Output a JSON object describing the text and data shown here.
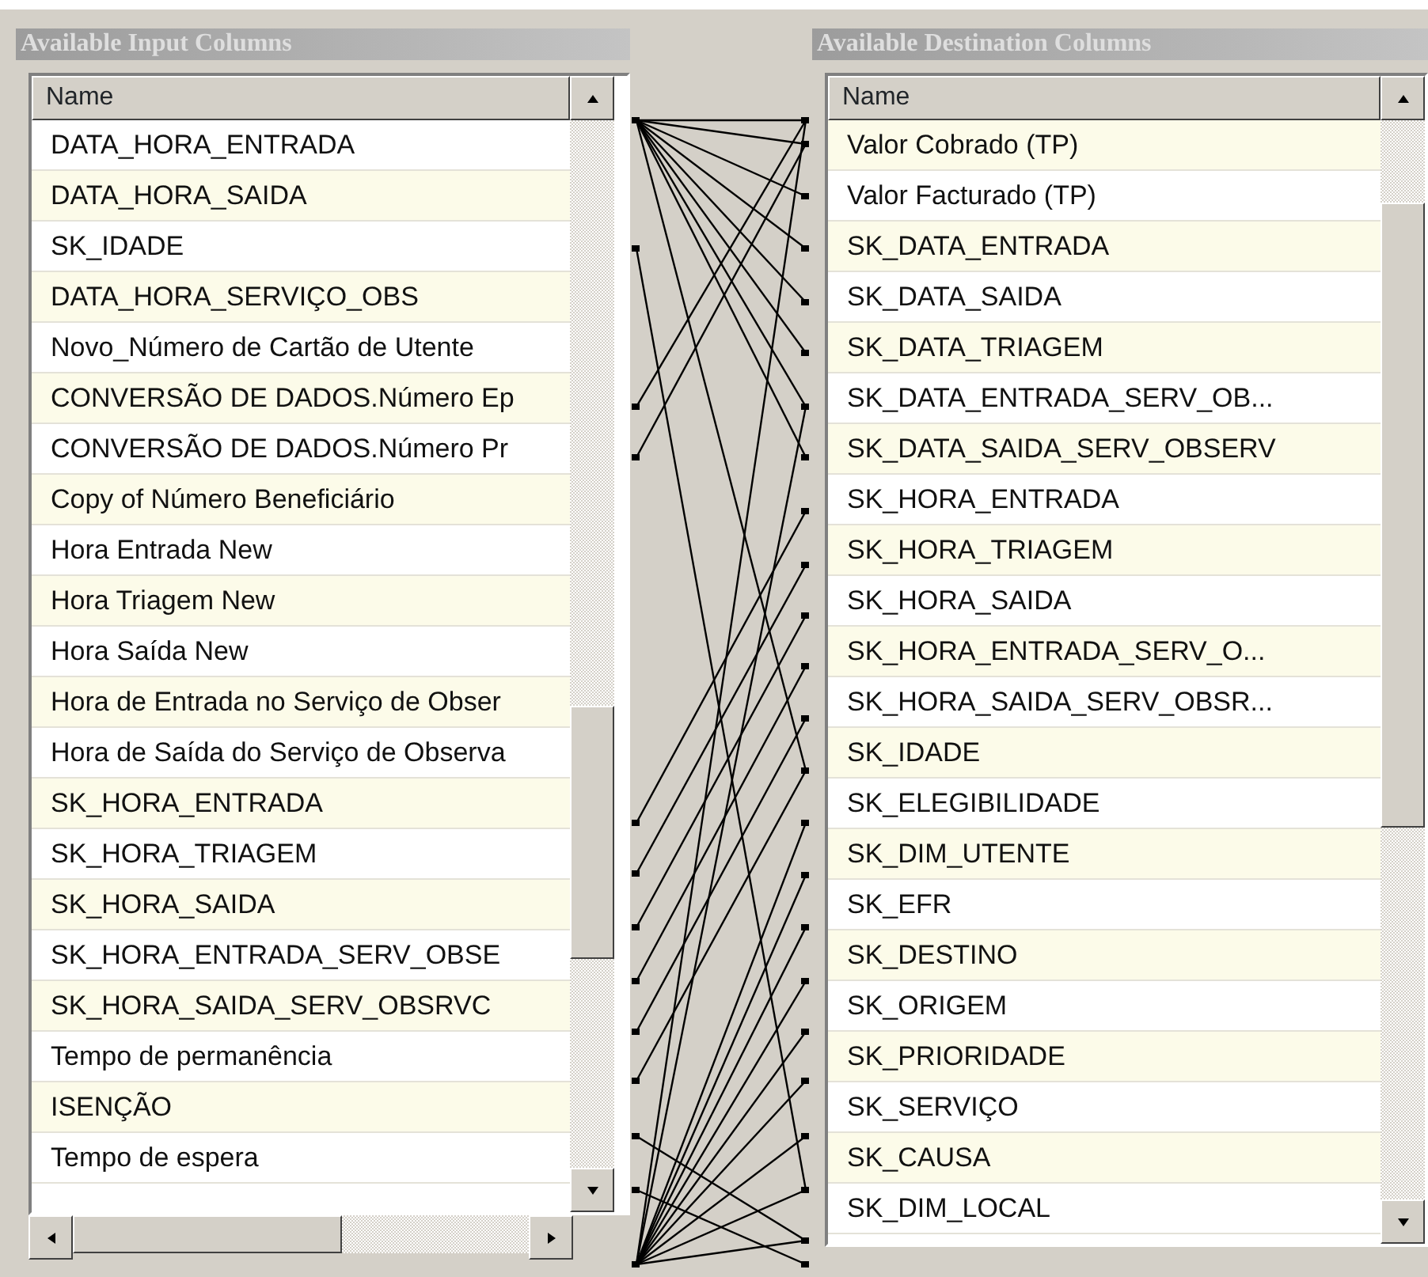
{
  "input_panel": {
    "title": "Available Input Columns",
    "header": "Name",
    "first_row_shaded": false,
    "rows": [
      "DATA_HORA_ENTRADA",
      "DATA_HORA_SAIDA",
      "SK_IDADE",
      "DATA_HORA_SERVIÇO_OBS",
      "Novo_Número de Cartão de Utente",
      "CONVERSÃO DE DADOS.Número Ep",
      "CONVERSÃO DE DADOS.Número Pr",
      "Copy of Número Beneficiário",
      "Hora Entrada New",
      "Hora Triagem New",
      "Hora Saída New",
      "Hora de Entrada no Serviço de Obser",
      "Hora de Saída do Serviço de Observa",
      "SK_HORA_ENTRADA",
      "SK_HORA_TRIAGEM",
      "SK_HORA_SAIDA",
      "SK_HORA_ENTRADA_SERV_OBSE",
      "SK_HORA_SAIDA_SERV_OBSRVC",
      "Tempo de permanência",
      "ISENÇÃO",
      "Tempo de espera"
    ]
  },
  "destination_panel": {
    "title": "Available Destination Columns",
    "header": "Name",
    "first_row_shaded": true,
    "rows": [
      "Valor Cobrado (TP)",
      "Valor Facturado (TP)",
      "SK_DATA_ENTRADA",
      "SK_DATA_SAIDA",
      "SK_DATA_TRIAGEM",
      "SK_DATA_ENTRADA_SERV_OB...",
      "SK_DATA_SAIDA_SERV_OBSERV",
      "SK_HORA_ENTRADA",
      "SK_HORA_TRIAGEM",
      "SK_HORA_SAIDA",
      "SK_HORA_ENTRADA_SERV_O...",
      "SK_HORA_SAIDA_SERV_OBSR...",
      "SK_IDADE",
      "SK_ELEGIBILIDADE",
      "SK_DIM_UTENTE",
      "SK_EFR",
      "SK_DESTINO",
      "SK_ORIGEM",
      "SK_PRIORIDADE",
      "SK_SERVIÇO",
      "SK_CAUSA",
      "SK_DIM_LOCAL"
    ]
  }
}
